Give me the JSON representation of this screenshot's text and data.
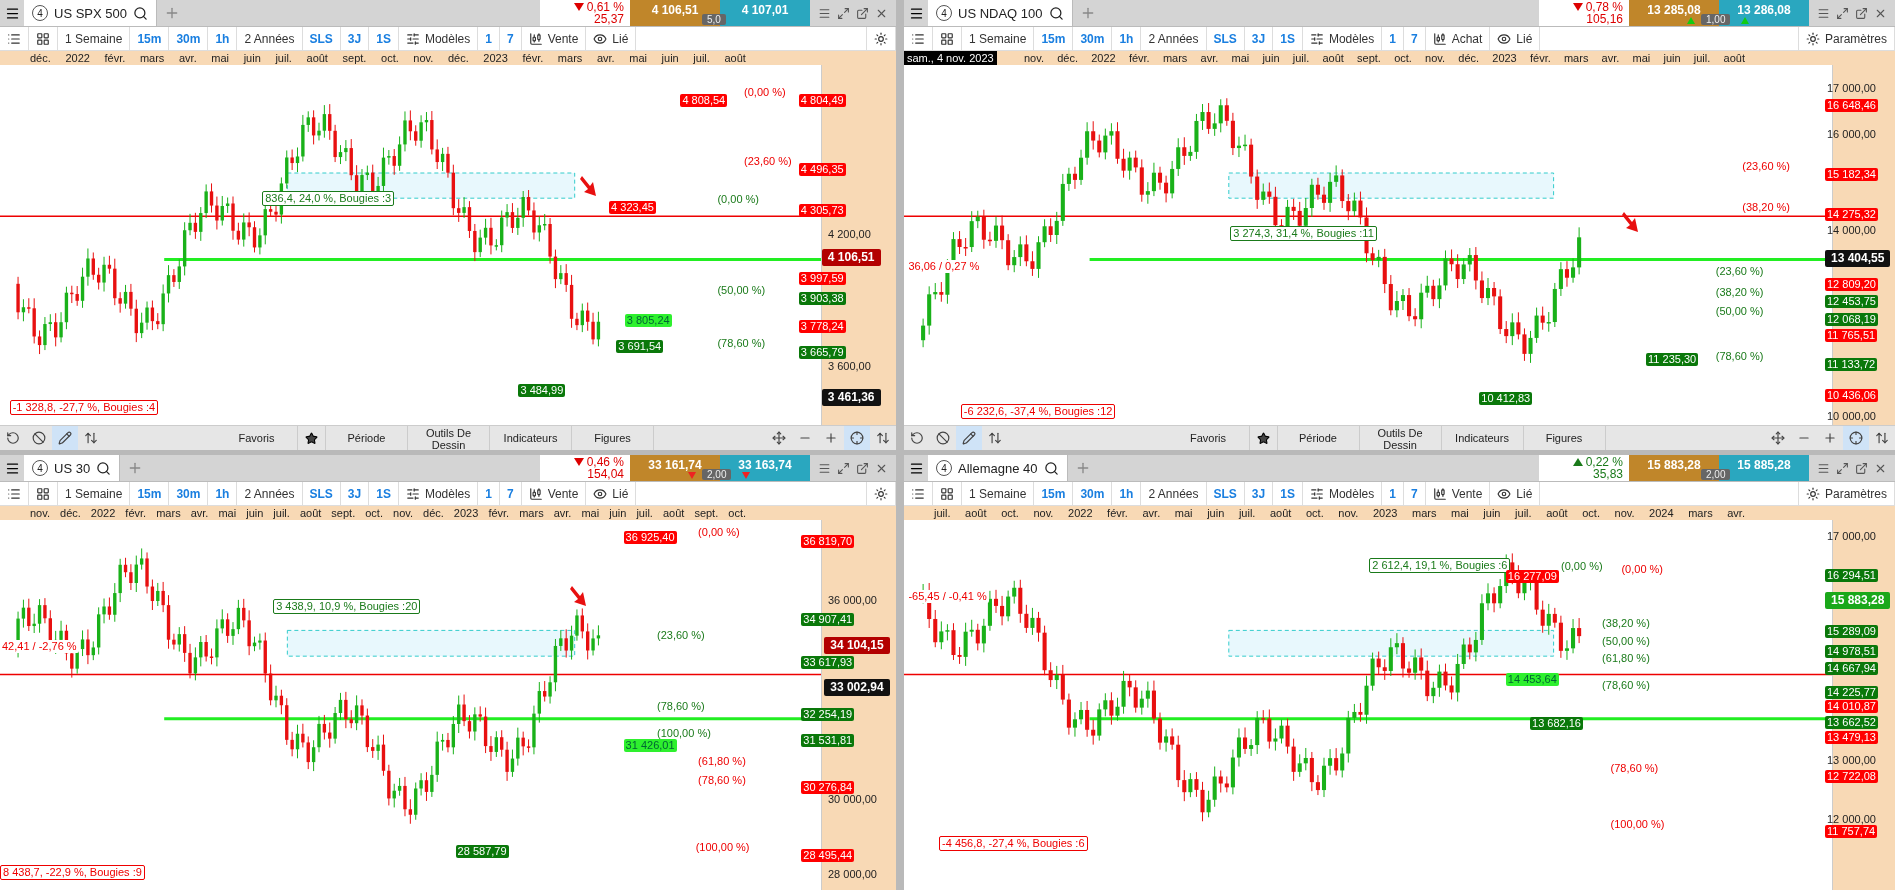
{
  "panels": [
    {
      "number": "4",
      "symbol": "US SPX 500",
      "change": {
        "rising": false,
        "percent": "0,61 %",
        "points": "25,37"
      },
      "bid": "4 106,51",
      "ask": "4 107,01",
      "spread": "5,0",
      "toolbar": {
        "period": "1 Semaine",
        "intervals": [
          "15m",
          "30m",
          "1h"
        ],
        "range": "2 Années",
        "modes": [
          "SLS",
          "3J",
          "1S"
        ],
        "templates": "Modèles",
        "counts": [
          "1",
          "7"
        ],
        "order": "Vente",
        "link": "Lié"
      },
      "months": [
        "déc.",
        "2022",
        "févr.",
        "mars",
        "avr.",
        "mai",
        "juin",
        "juil.",
        "août",
        "sept.",
        "oct.",
        "nov.",
        "déc.",
        "2023",
        "févr.",
        "mars",
        "avr.",
        "mai",
        "juin",
        "juil.",
        "août"
      ],
      "labels": [
        {
          "text": "4 808,54",
          "kind": "red"
        },
        {
          "text": "(0,00 %)",
          "kind": "pct-red"
        },
        {
          "text": "4 804,49",
          "kind": "red"
        },
        {
          "text": "(23,60 %)",
          "kind": "pct-red"
        },
        {
          "text": "4 496,35",
          "kind": "red"
        },
        {
          "text": "836,4, 24,0 %, Bougies :3",
          "kind": "outline-green"
        },
        {
          "text": "4 323,45",
          "kind": "red"
        },
        {
          "text": "(0,00 %)",
          "kind": "pct-green"
        },
        {
          "text": "4 305,73",
          "kind": "red"
        },
        {
          "text": "4 200,00",
          "kind": "tick"
        },
        {
          "text": "4 106,51",
          "kind": "price-red"
        },
        {
          "text": "(50,00 %)",
          "kind": "pct-green"
        },
        {
          "text": "3 997,59",
          "kind": "red"
        },
        {
          "text": "3 903,38",
          "kind": "green"
        },
        {
          "text": "3 805,24",
          "kind": "lime"
        },
        {
          "text": "3 778,24",
          "kind": "red"
        },
        {
          "text": "3 691,54",
          "kind": "green"
        },
        {
          "text": "(78,60 %)",
          "kind": "pct-green"
        },
        {
          "text": "3 665,79",
          "kind": "green"
        },
        {
          "text": "3 600,00",
          "kind": "tick"
        },
        {
          "text": "3 484,99",
          "kind": "green"
        },
        {
          "text": "3 461,36",
          "kind": "price-black"
        },
        {
          "text": "-1 328,8, -27,7 %, Bougies :4",
          "kind": "outline-red"
        }
      ],
      "bottom_toolbar": {
        "tabs": [
          "Favoris",
          "Période",
          "Outils De Dessin",
          "Indicateurs",
          "Figures"
        ]
      }
    },
    {
      "number": "4",
      "symbol": "US NDAQ 100",
      "change": {
        "rising": false,
        "percent": "0,78 %",
        "points": "105,16"
      },
      "bid": "13 285,08",
      "ask": "13 286,08",
      "spread": "1,00",
      "spread_rising": true,
      "toolbar": {
        "period": "1 Semaine",
        "intervals": [
          "15m",
          "30m",
          "1h"
        ],
        "range": "2 Années",
        "modes": [
          "SLS",
          "3J",
          "1S"
        ],
        "templates": "Modèles",
        "counts": [
          "1",
          "7"
        ],
        "order": "Achat",
        "link": "Lié",
        "settings": "Paramètres"
      },
      "date_tooltip": "sam., 4 nov. 2023",
      "months": [
        "nov.",
        "déc.",
        "2022",
        "févr.",
        "mars",
        "avr.",
        "mai",
        "juin",
        "juil.",
        "août",
        "sept.",
        "oct.",
        "nov.",
        "déc.",
        "2023",
        "févr.",
        "mars",
        "avr.",
        "mai",
        "juin",
        "juil.",
        "août"
      ],
      "labels": [
        {
          "text": "17 000,00",
          "kind": "tick"
        },
        {
          "text": "16 648,46",
          "kind": "red"
        },
        {
          "text": "16 000,00",
          "kind": "tick"
        },
        {
          "text": "(23,60 %)",
          "kind": "pct-red"
        },
        {
          "text": "15 182,34",
          "kind": "red"
        },
        {
          "text": "(38,20 %)",
          "kind": "pct-red"
        },
        {
          "text": "14 275,32",
          "kind": "red"
        },
        {
          "text": "14 000,00",
          "kind": "tick"
        },
        {
          "text": "3 274,3, 31,4 %, Bougies :11",
          "kind": "outline-green"
        },
        {
          "text": "13 404,55",
          "kind": "price-black"
        },
        {
          "text": "36,06 / 0,27 %",
          "kind": "text-red"
        },
        {
          "text": "(23,60 %)",
          "kind": "pct-green"
        },
        {
          "text": "12 809,20",
          "kind": "red"
        },
        {
          "text": "(38,20 %)",
          "kind": "pct-green"
        },
        {
          "text": "12 453,75",
          "kind": "green"
        },
        {
          "text": "(50,00 %)",
          "kind": "pct-green"
        },
        {
          "text": "12 068,19",
          "kind": "green"
        },
        {
          "text": "11 765,51",
          "kind": "red"
        },
        {
          "text": "11 235,30",
          "kind": "green"
        },
        {
          "text": "(78,60 %)",
          "kind": "pct-green"
        },
        {
          "text": "11 133,72",
          "kind": "green"
        },
        {
          "text": "10 412,83",
          "kind": "green"
        },
        {
          "text": "10 436,06",
          "kind": "red"
        },
        {
          "text": "-6 232,6, -37,4 %, Bougies :12",
          "kind": "outline-red"
        },
        {
          "text": "10 000,00",
          "kind": "tick"
        }
      ],
      "bottom_toolbar": {
        "tabs": [
          "Favoris",
          "Période",
          "Outils De Dessin",
          "Indicateurs",
          "Figures"
        ]
      }
    },
    {
      "number": "4",
      "symbol": "US 30",
      "change": {
        "rising": false,
        "percent": "0,46 %",
        "points": "154,04"
      },
      "bid": "33 161,74",
      "ask": "33 163,74",
      "spread": "2,00",
      "spread_rising": false,
      "toolbar": {
        "period": "1 Semaine",
        "intervals": [
          "15m",
          "30m",
          "1h"
        ],
        "range": "2 Années",
        "modes": [
          "SLS",
          "3J",
          "1S"
        ],
        "templates": "Modèles",
        "counts": [
          "1",
          "7"
        ],
        "order": "Vente",
        "link": "Lié"
      },
      "months": [
        "nov.",
        "déc.",
        "2022",
        "févr.",
        "mars",
        "avr.",
        "mai",
        "juin",
        "juil.",
        "août",
        "sept.",
        "oct.",
        "nov.",
        "déc.",
        "2023",
        "févr.",
        "mars",
        "avr.",
        "mai",
        "juin",
        "juil.",
        "août",
        "sept.",
        "oct."
      ],
      "labels": [
        {
          "text": "36 925,40",
          "kind": "red"
        },
        {
          "text": "(0,00 %)",
          "kind": "pct-red"
        },
        {
          "text": "36 819,70",
          "kind": "red"
        },
        {
          "text": "36 000,00",
          "kind": "tick"
        },
        {
          "text": "3 438,9, 10,9 %, Bougies :20",
          "kind": "outline-green"
        },
        {
          "text": "34 907,41",
          "kind": "green"
        },
        {
          "text": "(23,60 %)",
          "kind": "pct-green"
        },
        {
          "text": "34 104,15",
          "kind": "price-red"
        },
        {
          "text": "42,41 / -2,76 %",
          "kind": "text-red"
        },
        {
          "text": "33 617,93",
          "kind": "green"
        },
        {
          "text": "33 002,94",
          "kind": "price-black"
        },
        {
          "text": "(78,60 %)",
          "kind": "pct-green"
        },
        {
          "text": "32 254,19",
          "kind": "green"
        },
        {
          "text": "(100,00 %)",
          "kind": "pct-green"
        },
        {
          "text": "31 531,81",
          "kind": "green"
        },
        {
          "text": "31 426,01",
          "kind": "lime"
        },
        {
          "text": "(61,80 %)",
          "kind": "pct-red"
        },
        {
          "text": "(78,60 %)",
          "kind": "pct-red"
        },
        {
          "text": "30 276,84",
          "kind": "red"
        },
        {
          "text": "30 000,00",
          "kind": "tick"
        },
        {
          "text": "28 587,79",
          "kind": "green"
        },
        {
          "text": "(100,00 %)",
          "kind": "pct-red"
        },
        {
          "text": "28 495,44",
          "kind": "red"
        },
        {
          "text": "28 000,00",
          "kind": "tick"
        },
        {
          "text": "8 438,7, -22,9 %, Bougies :9",
          "kind": "outline-red"
        }
      ]
    },
    {
      "number": "4",
      "symbol": "Allemagne 40",
      "change": {
        "rising": true,
        "percent": "0,22 %",
        "points": "35,83"
      },
      "bid": "15 883,28",
      "ask": "15 885,28",
      "spread": "2,00",
      "toolbar": {
        "period": "1 Semaine",
        "intervals": [
          "15m",
          "30m",
          "1h"
        ],
        "range": "2 Années",
        "modes": [
          "SLS",
          "3J",
          "1S"
        ],
        "templates": "Modèles",
        "counts": [
          "1",
          "7"
        ],
        "order": "Vente",
        "link": "Lié",
        "settings": "Paramètres"
      },
      "months": [
        "juil.",
        "août",
        "oct.",
        "nov.",
        "2022",
        "févr.",
        "avr.",
        "mai",
        "juin",
        "juil.",
        "août",
        "oct.",
        "nov.",
        "2023",
        "mars",
        "mai",
        "juin",
        "juil.",
        "août",
        "oct.",
        "nov.",
        "2024",
        "mars",
        "avr."
      ],
      "labels": [
        {
          "text": "17 000,00",
          "kind": "tick"
        },
        {
          "text": "2 612,4, 19,1 %, Bougies :6",
          "kind": "outline-green"
        },
        {
          "text": "(0,00 %)",
          "kind": "pct-green"
        },
        {
          "text": "(0,00 %)",
          "kind": "pct-red"
        },
        {
          "text": "16 277,09",
          "kind": "red"
        },
        {
          "text": "16 294,51",
          "kind": "green"
        },
        {
          "text": "-65,45 / -0,41 %",
          "kind": "text-red"
        },
        {
          "text": "15 883,28",
          "kind": "price-green"
        },
        {
          "text": "(38,20 %)",
          "kind": "pct-green"
        },
        {
          "text": "15 289,09",
          "kind": "green"
        },
        {
          "text": "(50,00 %)",
          "kind": "pct-green"
        },
        {
          "text": "14 978,51",
          "kind": "green"
        },
        {
          "text": "(61,80 %)",
          "kind": "pct-green"
        },
        {
          "text": "14 667,94",
          "kind": "green"
        },
        {
          "text": "14 453,64",
          "kind": "lime"
        },
        {
          "text": "(78,60 %)",
          "kind": "pct-green"
        },
        {
          "text": "14 225,77",
          "kind": "green"
        },
        {
          "text": "14 010,87",
          "kind": "red"
        },
        {
          "text": "13 682,16",
          "kind": "green"
        },
        {
          "text": "13 662,52",
          "kind": "green"
        },
        {
          "text": "13 479,13",
          "kind": "red"
        },
        {
          "text": "13 000,00",
          "kind": "tick"
        },
        {
          "text": "(78,60 %)",
          "kind": "pct-red"
        },
        {
          "text": "12 722,08",
          "kind": "red"
        },
        {
          "text": "12 000,00",
          "kind": "tick"
        },
        {
          "text": "(100,00 %)",
          "kind": "pct-red"
        },
        {
          "text": "11 757,74",
          "kind": "red"
        },
        {
          "text": "-4 456,8, -27,4 %, Bougies :6",
          "kind": "outline-red"
        }
      ]
    }
  ]
}
